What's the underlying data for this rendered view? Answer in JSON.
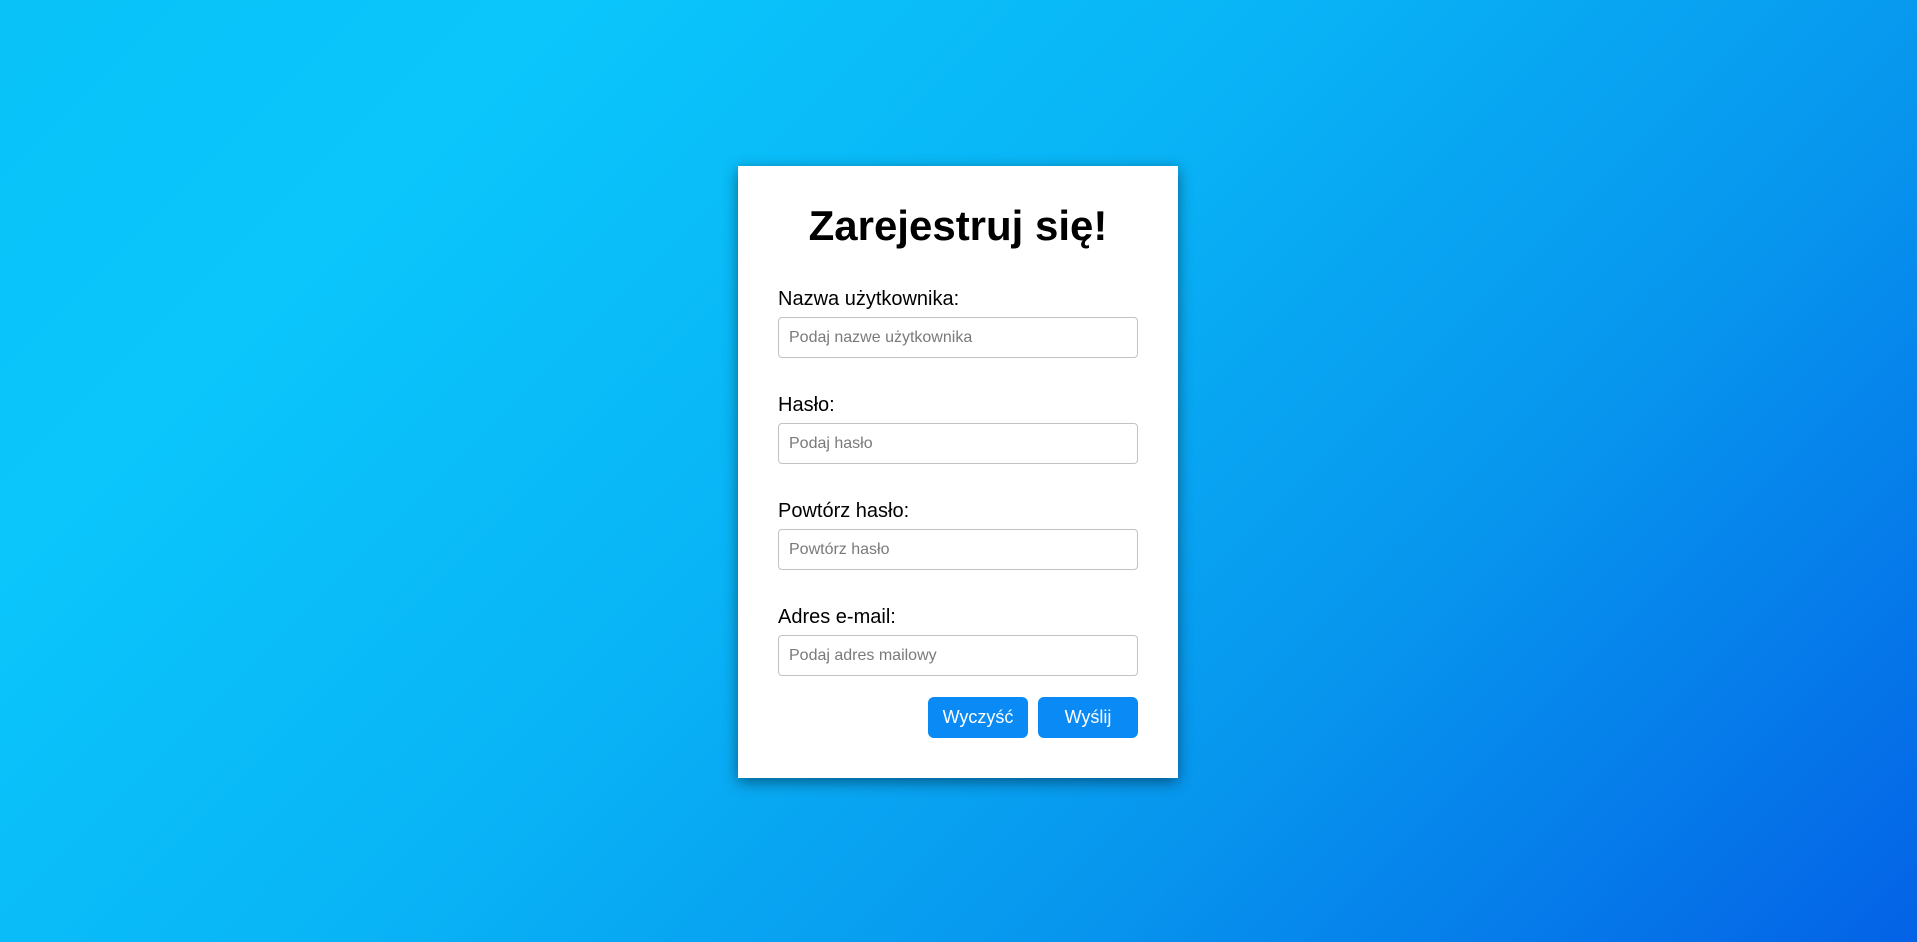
{
  "form": {
    "title": "Zarejestruj się!",
    "fields": [
      {
        "label": "Nazwa użytkownika:",
        "placeholder": "Podaj nazwe użytkownika",
        "value": ""
      },
      {
        "label": "Hasło:",
        "placeholder": "Podaj hasło",
        "value": ""
      },
      {
        "label": "Powtórz hasło:",
        "placeholder": "Powtórz hasło",
        "value": ""
      },
      {
        "label": "Adres e-mail:",
        "placeholder": "Podaj adres mailowy",
        "value": ""
      }
    ],
    "clear_label": "Wyczyść",
    "submit_label": "Wyślij"
  },
  "colors": {
    "background_start": "#08c2f8",
    "background_end": "#0462e6",
    "button": "#0a8af5",
    "card": "#ffffff"
  }
}
